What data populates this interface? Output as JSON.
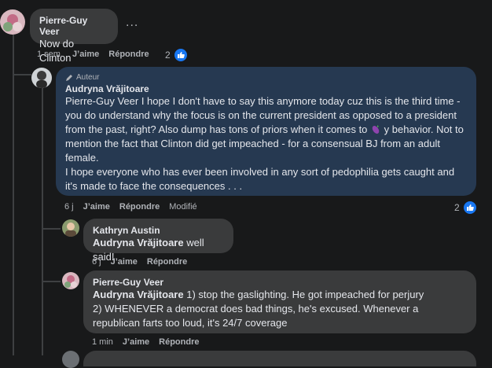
{
  "comments": [
    {
      "author": "Pierre-Guy Veer",
      "text": "Now do Clinton",
      "time": "1 sem.",
      "like": "J’aime",
      "reply": "Répondre",
      "reactions": "2"
    },
    {
      "badge": "Auteur",
      "author": "Audryna Vrăjitoare",
      "text_before": "Pierre-Guy Veer I hope I don't have to say this anymore today cuz this is the third time - you do understand why the focus is on the current president as opposed to a president from the past, right? Also dump has tons of priors when it comes to ",
      "text_after": " y behavior. Not to mention the fact that Clinton did get impeached - for a consensual BJ from an adult female.\nI hope everyone who has ever been involved in any sort of pedophilia gets caught and it's made to face the consequences . . .",
      "emoji_icon": "eggplant-icon",
      "time": "6 j",
      "like": "J’aime",
      "reply": "Répondre",
      "edited": "Modifié",
      "reactions": "2"
    },
    {
      "author": "Kathryn Austin",
      "mention": "Audryna Vrăjitoare",
      "text": " well said!",
      "time": "6 j",
      "like": "J’aime",
      "reply": "Répondre"
    },
    {
      "author": "Pierre-Guy Veer",
      "mention": "Audryna Vrăjitoare",
      "text": " 1) stop the gaslighting. He got impeached for perjury\n2) WHENEVER a democrat does bad things, he's excused. Whenever a republican farts too loud, it's 24/7 coverage",
      "time": "1 min",
      "like": "J’aime",
      "reply": "Répondre"
    }
  ],
  "more_options": "...",
  "colors": {
    "background": "#18191a",
    "bubble": "#3a3b3c",
    "highlight_bubble": "#263951",
    "like_blue": "#1877f2"
  }
}
